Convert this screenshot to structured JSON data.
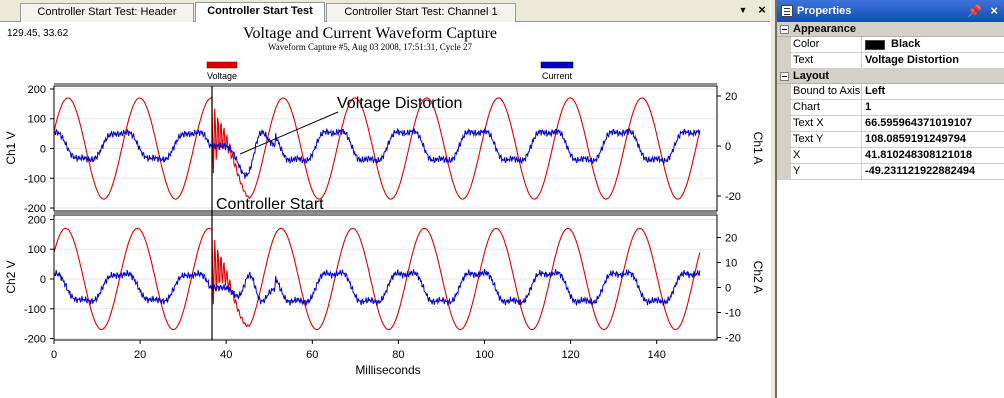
{
  "tabs": [
    {
      "label": "Controller Start Test: Header",
      "active": false
    },
    {
      "label": "Controller Start Test",
      "active": true
    },
    {
      "label": "Controller Start Test: Channel 1",
      "active": false
    }
  ],
  "tab_controls": {
    "scroll_arrow": "▼",
    "close": "×"
  },
  "cursor_readout": "129.45, 33.62",
  "chart_data": {
    "type": "line",
    "title": "Voltage and Current Waveform Capture",
    "subtitle": "Waveform Capture #5, Aug 03 2008, 17:51:31,  Cycle 27",
    "legend": [
      {
        "name": "Voltage",
        "color": "#e00000"
      },
      {
        "name": "Current",
        "color": "#0000c8"
      }
    ],
    "xlabel": "Milliseconds",
    "xlim": [
      0,
      154
    ],
    "xticks": [
      0,
      20,
      40,
      60,
      80,
      100,
      120,
      140
    ],
    "panels": [
      {
        "name": "Ch1",
        "ylabel_left": "Ch1 V",
        "ylabel_right": "Ch1 A",
        "ylim_left": [
          -210,
          210
        ],
        "yticks_left": [
          -200,
          -100,
          0,
          100,
          200
        ],
        "ylim_right": [
          -26,
          24
        ],
        "yticks_right": [
          -20,
          0,
          20
        ]
      },
      {
        "name": "Ch2",
        "ylabel_left": "Ch2 V",
        "ylabel_right": "Ch2 A",
        "ylim_left": [
          -205,
          215
        ],
        "yticks_left": [
          -200,
          -100,
          0,
          100,
          200
        ],
        "ylim_right": [
          -21,
          29
        ],
        "yticks_right": [
          -20,
          -10,
          0,
          10,
          20
        ]
      }
    ],
    "series": [
      {
        "name": "Voltage",
        "axis": "left",
        "amplitude_v": 170,
        "frequency_hz": 60,
        "color": "#e00000"
      },
      {
        "name": "Current",
        "axis": "right",
        "amplitude_a": 6,
        "color": "#0000c8"
      }
    ],
    "annotations": [
      {
        "text": "Voltage Distortion",
        "x_ms": 66.6,
        "y_v": 108.1
      },
      {
        "text": "Controller Start",
        "x_ms": 36.5
      }
    ],
    "x_end_ms": 150
  },
  "properties": {
    "title": "Properties",
    "categories": [
      {
        "name": "Appearance",
        "rows": [
          {
            "name": "Color",
            "value": "Black",
            "swatch": "#000000"
          },
          {
            "name": "Text",
            "value": "Voltage Distortion"
          }
        ]
      },
      {
        "name": "Layout",
        "rows": [
          {
            "name": "Bound to Axis",
            "value": "Left"
          },
          {
            "name": "Chart",
            "value": "1"
          },
          {
            "name": "Text X",
            "value": "66.595964371019107"
          },
          {
            "name": "Text Y",
            "value": "108.0859191249794"
          },
          {
            "name": "X",
            "value": "41.810248308121018"
          },
          {
            "name": "Y",
            "value": "-49.231121922882494"
          }
        ]
      }
    ]
  }
}
